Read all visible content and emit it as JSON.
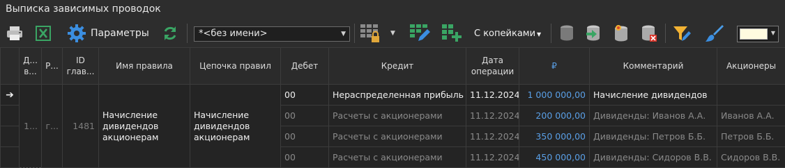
{
  "window": {
    "title": "Выписка зависимых проводок"
  },
  "toolbar": {
    "params_label": "Параметры",
    "template_value": "*<без имени>",
    "kopecks_label": "С копейками",
    "icons": [
      "printer-icon",
      "excel-icon",
      "gear-icon",
      "refresh-icon",
      "grid-lock-icon",
      "grid-edit-icon",
      "grid-add-icon",
      "db-icon",
      "db-import-icon",
      "db-new-icon",
      "db-delete-icon",
      "filter-edit-icon",
      "brush-icon"
    ],
    "color_value": "#fffbe0"
  },
  "grid": {
    "columns": [
      "Д... в...",
      "Р...",
      "ID глав...",
      "Имя правила",
      "Цепочка правил",
      "Дебет",
      "Кредит",
      "Дата операции",
      "₽",
      "Комментарий",
      "Акционеры"
    ],
    "group": {
      "col1": "1...",
      "col2": "г...",
      "id": "1481",
      "rule_name": "Начисление дивидендов акционерам",
      "rule_chain": "Начисление дивидендов акционерам"
    },
    "rows": [
      {
        "debit": "00",
        "credit": "Нераспределенная прибыль",
        "date": "11.12.2024",
        "amount": "1 000 000,00",
        "comment": "Начисление дивидендов",
        "holder": ""
      },
      {
        "debit": "00",
        "credit": "Расчеты с акционерами",
        "date": "11.12.2024",
        "amount": "200 000,00",
        "comment": "Дивиденды: Иванов А.А.",
        "holder": "Иванов А.А."
      },
      {
        "debit": "00",
        "credit": "Расчеты с акционерами",
        "date": "11.12.2024",
        "amount": "350 000,00",
        "comment": "Дивиденды: Петров Б.Б.",
        "holder": "Петров Б.Б."
      },
      {
        "debit": "00",
        "credit": "Расчеты с акционерами",
        "date": "11.12.2024",
        "amount": "450 000,00",
        "comment": "Дивиденды: Сидоров В.В.",
        "holder": "Сидоров В.В."
      }
    ]
  },
  "colors": {
    "accent": "#5a9fe6",
    "background": "#2b2b2b"
  }
}
